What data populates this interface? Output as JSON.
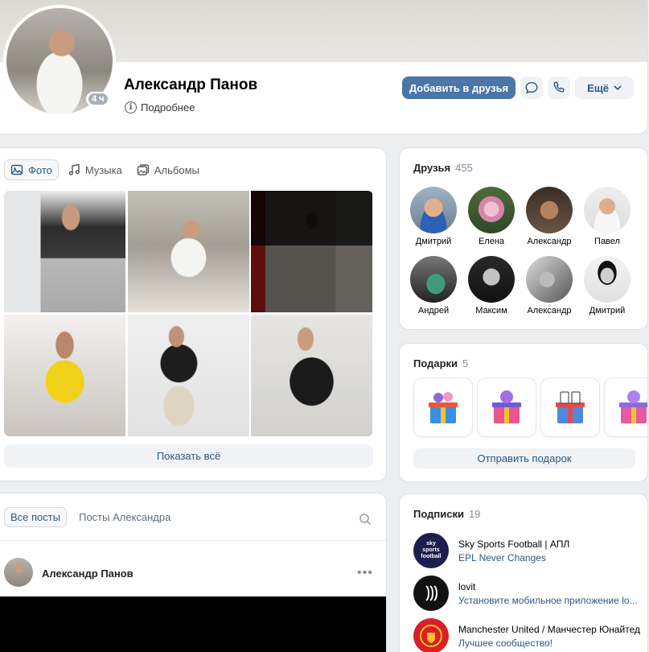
{
  "profile": {
    "name": "Александр Панов",
    "online": "4 ч",
    "info_label": "Подробнее",
    "actions": {
      "add_friend": "Добавить в друзья",
      "more": "Ещё"
    }
  },
  "media": {
    "tabs": [
      {
        "label": "Фото",
        "icon": "image-icon"
      },
      {
        "label": "Музыка",
        "icon": "music-note-icon"
      },
      {
        "label": "Альбомы",
        "icon": "albums-icon"
      }
    ],
    "show_all": "Показать всё"
  },
  "posts": {
    "tabs": [
      "Все посты",
      "Посты Александра"
    ],
    "first_author": "Александр Панов"
  },
  "friends": {
    "title": "Друзья",
    "count": "455",
    "items": [
      "Дмитрий",
      "Елена",
      "Александр",
      "Павел",
      "Андрей",
      "Максим",
      "Александр",
      "Дмитрий"
    ]
  },
  "gifts": {
    "title": "Подарки",
    "count": "5",
    "send": "Отправить подарок"
  },
  "subscriptions": {
    "title": "Подписки",
    "count": "19",
    "items": [
      {
        "name": "Sky Sports Football | АПЛ",
        "desc": "EPL Never Changes",
        "logo_text": "sky sports football"
      },
      {
        "name": "lovit",
        "desc": "Установите мобильное приложение lo..."
      },
      {
        "name": "Manchester United / Манчестер Юнайтед",
        "desc": "Лучшее сообщество!"
      }
    ]
  },
  "colors": {
    "accent": "#4a76a8",
    "link": "#2a5885",
    "muted": "#818c99",
    "background": "#edeef0"
  }
}
